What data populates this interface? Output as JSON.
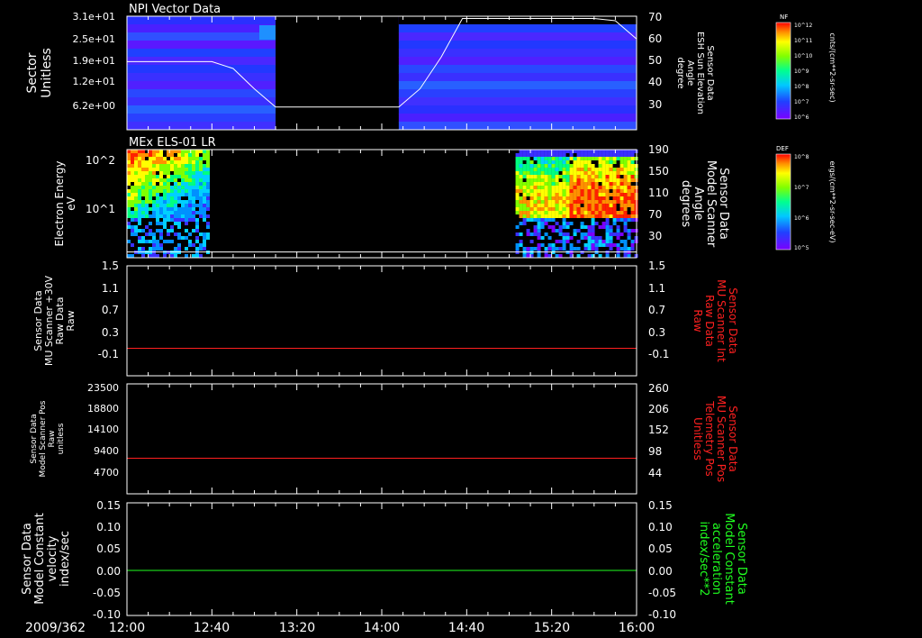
{
  "figure": {
    "date_label": "2009/362",
    "time_ticks": [
      "12:00",
      "12:40",
      "13:20",
      "14:00",
      "14:40",
      "15:20",
      "16:00"
    ]
  },
  "colors": {
    "background": "#000000",
    "axis": "#ffffff",
    "red_trace": "#ff2020",
    "green_trace": "#20ff20",
    "white_trace": "#ffffff"
  },
  "chart_data": [
    {
      "type": "heatmap",
      "title": "NPI Vector Data",
      "ylabel": [
        "Sector",
        "Unitless"
      ],
      "yticks": [
        "3.1e+01",
        "2.5e+01",
        "1.9e+01",
        "1.2e+01",
        "6.2e+00"
      ],
      "y2label": [
        "Sensor Data",
        "ESH Sun Elevation",
        "Angle",
        "degree"
      ],
      "y2ticks": [
        "70",
        "60",
        "50",
        "40",
        "30"
      ],
      "y2lim": [
        20,
        70
      ],
      "colorbar": {
        "label": "NF",
        "units": "cnts/(cm**2-sr-sec)",
        "ticks": [
          "10^12",
          "10^11",
          "10^10",
          "10^9",
          "10^8",
          "10^7",
          "10^6"
        ]
      },
      "data_gaps": [
        [
          "13:10",
          "14:08"
        ]
      ],
      "overlay_series": {
        "name": "ESH Sun Elevation Angle",
        "x": [
          "12:00",
          "12:40",
          "12:50",
          "13:00",
          "13:10",
          "14:08",
          "14:18",
          "14:28",
          "14:38",
          "15:40",
          "15:50",
          "16:00"
        ],
        "y": [
          50,
          50,
          47,
          38,
          30,
          30,
          38,
          52,
          69,
          69,
          68,
          60
        ]
      }
    },
    {
      "type": "heatmap",
      "title": "MEx ELS-01 LR",
      "ylabel": [
        "Electron Energy",
        "eV"
      ],
      "yticks": [
        "10^2",
        "10^1"
      ],
      "y2label": [
        "Sensor Data",
        "Model Scanner",
        "Angle",
        "degrees"
      ],
      "y2ticks": [
        "190",
        "150",
        "110",
        "70",
        "30"
      ],
      "y2lim": [
        0,
        190
      ],
      "colorbar": {
        "label": "DEF",
        "units": "ergs/(cm**2-sr-sec-eV)",
        "ticks": [
          "10^8",
          "10^7",
          "10^6",
          "10^5"
        ]
      },
      "data_intervals": [
        [
          "12:00",
          "12:38"
        ],
        [
          "15:03",
          "16:00"
        ]
      ],
      "overlay_series": {
        "name": "Model Scanner Angle",
        "x": [
          "12:00",
          "16:00"
        ],
        "y": [
          10,
          10
        ]
      }
    },
    {
      "type": "line",
      "ylabel": [
        "Sensor Data",
        "MU Scanner +30V",
        "Raw Data",
        "Raw"
      ],
      "yticks": [
        "1.5",
        "1.1",
        "0.7",
        "0.3",
        "-0.1"
      ],
      "ylim": [
        -0.5,
        1.5
      ],
      "y2label": [
        "Sensor Data",
        "MU Scanner Int",
        "Raw Data",
        "Raw"
      ],
      "y2ticks": [
        "1.5",
        "1.1",
        "0.7",
        "0.3",
        "-0.1"
      ],
      "series": [
        {
          "x": [
            "12:00",
            "16:00"
          ],
          "y": [
            0.0,
            0.0
          ],
          "color": "#ff2020"
        }
      ]
    },
    {
      "type": "line",
      "ylabel": [
        "Sensor Data",
        "Model Scanner Pos",
        "Raw",
        "unitless"
      ],
      "yticks": [
        "23500",
        "18800",
        "14100",
        "9400",
        "4700"
      ],
      "ylim": [
        0,
        23500
      ],
      "y2label": [
        "Sensor Data",
        "MU Scanner Pos",
        "Telemetry Pos",
        "Unitless"
      ],
      "y2ticks": [
        "260",
        "206",
        "152",
        "98",
        "44"
      ],
      "series": [
        {
          "x": [
            "12:00",
            "16:00"
          ],
          "y": [
            7600,
            7600
          ],
          "color": "#ff2020"
        }
      ]
    },
    {
      "type": "line",
      "ylabel": [
        "Sensor Data",
        "Model Constant",
        "velocity",
        "index/sec"
      ],
      "yticks": [
        "0.15",
        "0.10",
        "0.05",
        "0.00",
        "-0.05",
        "-0.10"
      ],
      "ylim": [
        -0.1,
        0.15
      ],
      "y2label": [
        "Sensor Data",
        "Model Constant",
        "acceleration",
        "index/sec**2"
      ],
      "y2ticks": [
        "0.15",
        "0.10",
        "0.05",
        "0.00",
        "-0.05",
        "-0.10"
      ],
      "series": [
        {
          "x": [
            "12:00",
            "16:00"
          ],
          "y": [
            0.0,
            0.0
          ],
          "color": "#20ff20"
        }
      ]
    }
  ]
}
